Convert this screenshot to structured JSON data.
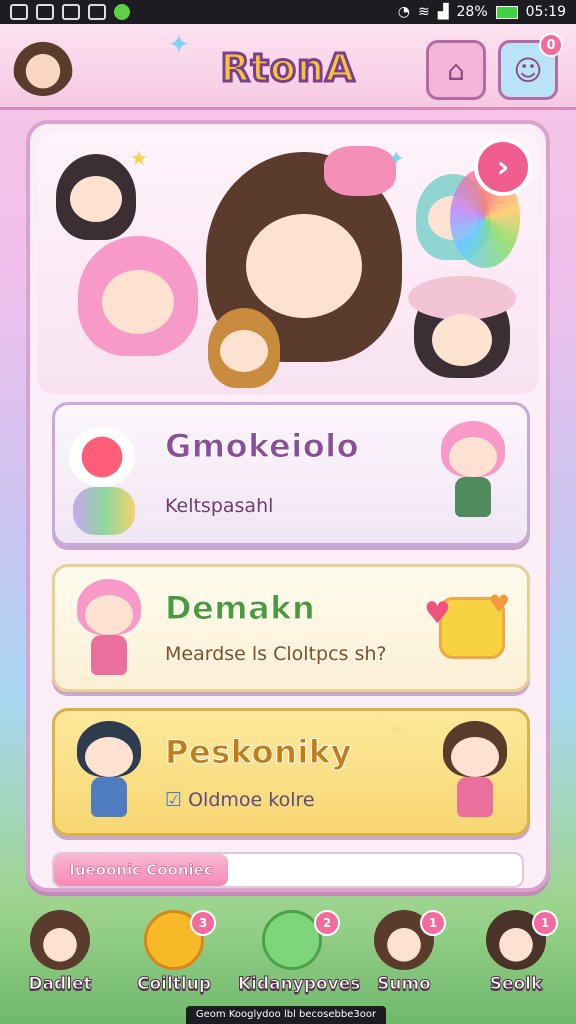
{
  "status_bar": {
    "battery_text": "28%",
    "time": "05:19"
  },
  "header": {
    "logo": "RtonA",
    "home_label": "⌂",
    "bag_badge": "0"
  },
  "hero": {
    "next_label": "›"
  },
  "cards": [
    {
      "title": "Gmokeiolo",
      "subtitle": "Keltspasahl"
    },
    {
      "title": "Demakn",
      "subtitle": "Meardse ls Cloltpcs sh?"
    },
    {
      "title": "Peskoniky",
      "subtitle": "Oldmoe kolre",
      "checkbox": "☑"
    }
  ],
  "footer_tab": {
    "label": "Iueoonic Cooniec"
  },
  "bottom_nav": [
    {
      "label": "Dadlet",
      "badge": ""
    },
    {
      "label": "Coiltlup",
      "badge": "3"
    },
    {
      "label": "Kidanypoves",
      "badge": "2"
    },
    {
      "label": "Sumo",
      "badge": "1"
    },
    {
      "label": "Seolk",
      "badge": "1"
    }
  ],
  "bottom_caption": "Geom Kooglydoo lbl becosebbe3oor",
  "colors": {
    "accent": "#f05d8f",
    "panel_border": "#d9a3ce",
    "title_purple": "#8b4e9a",
    "title_green": "#4a9b3a",
    "title_orange": "#c17d17"
  }
}
